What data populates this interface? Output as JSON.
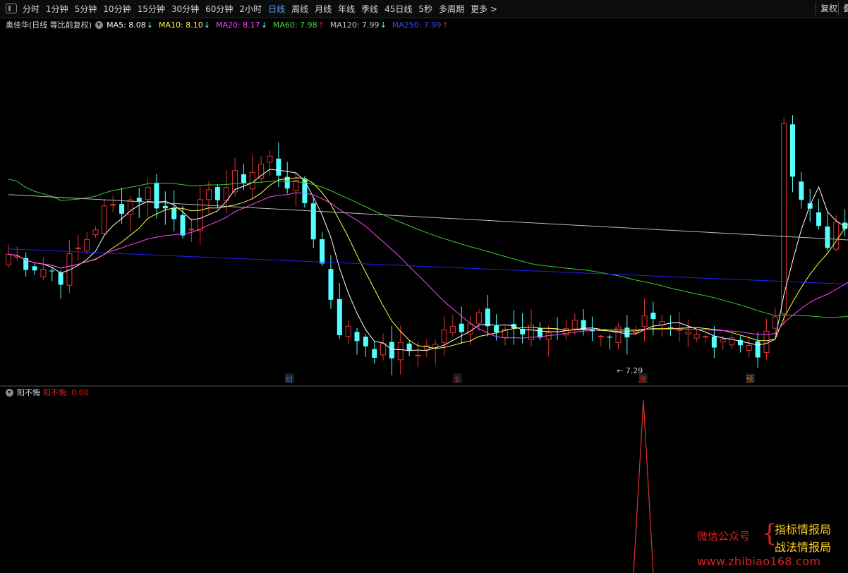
{
  "toolbar": {
    "periods": [
      "分时",
      "1分钟",
      "5分钟",
      "10分钟",
      "15分钟",
      "30分钟",
      "60分钟",
      "2小时",
      "日线",
      "周线",
      "月线",
      "年线",
      "季线",
      "45日线",
      "5秒",
      "多周期",
      "更多 >"
    ],
    "active_period": "日线",
    "fuquan_label": "复权",
    "overlay_label": "叠"
  },
  "main_chart": {
    "stock_title": "奥佳华(日线 等比前复权)",
    "ma_legend": [
      {
        "label": "MA5: 8.08",
        "arrow": "↓",
        "color": "#ffffff"
      },
      {
        "label": "MA10: 8.10",
        "arrow": "↓",
        "color": "#ffff44"
      },
      {
        "label": "MA20: 8.17",
        "arrow": "↓",
        "color": "#ff44ff"
      },
      {
        "label": "MA60: 7.98",
        "arrow": "↑",
        "color": "#44dd44"
      },
      {
        "label": "MA120: 7.99",
        "arrow": "↓",
        "color": "#c8c8c8"
      },
      {
        "label": "MA250: 7.99",
        "arrow": "↑",
        "color": "#4444ff"
      }
    ],
    "low_annotation": "← 7.29",
    "event_markers": [
      {
        "char": "财",
        "color": "#2a6fd6"
      },
      {
        "char": "$",
        "color": "#e02020"
      },
      {
        "char": "涨",
        "color": "#e02020"
      },
      {
        "char": "预",
        "color": "#d07020"
      }
    ]
  },
  "sub_chart": {
    "name": "阳不悔",
    "value_label": "阳不悔: 0.00",
    "value_color": "#e02020"
  },
  "watermark": {
    "left": "微信公众号",
    "right_line1": "指标情报局",
    "right_line2": "战法情报局",
    "url": "www.zhibiao168.com"
  },
  "colors": {
    "up": "#e0342e",
    "down": "#54ffff",
    "ma5": "#ffffff",
    "ma10": "#ffff44",
    "ma20": "#ff44ff",
    "ma60": "#33cc33",
    "ma120": "#bbbbbb",
    "ma250": "#2222ee"
  }
}
